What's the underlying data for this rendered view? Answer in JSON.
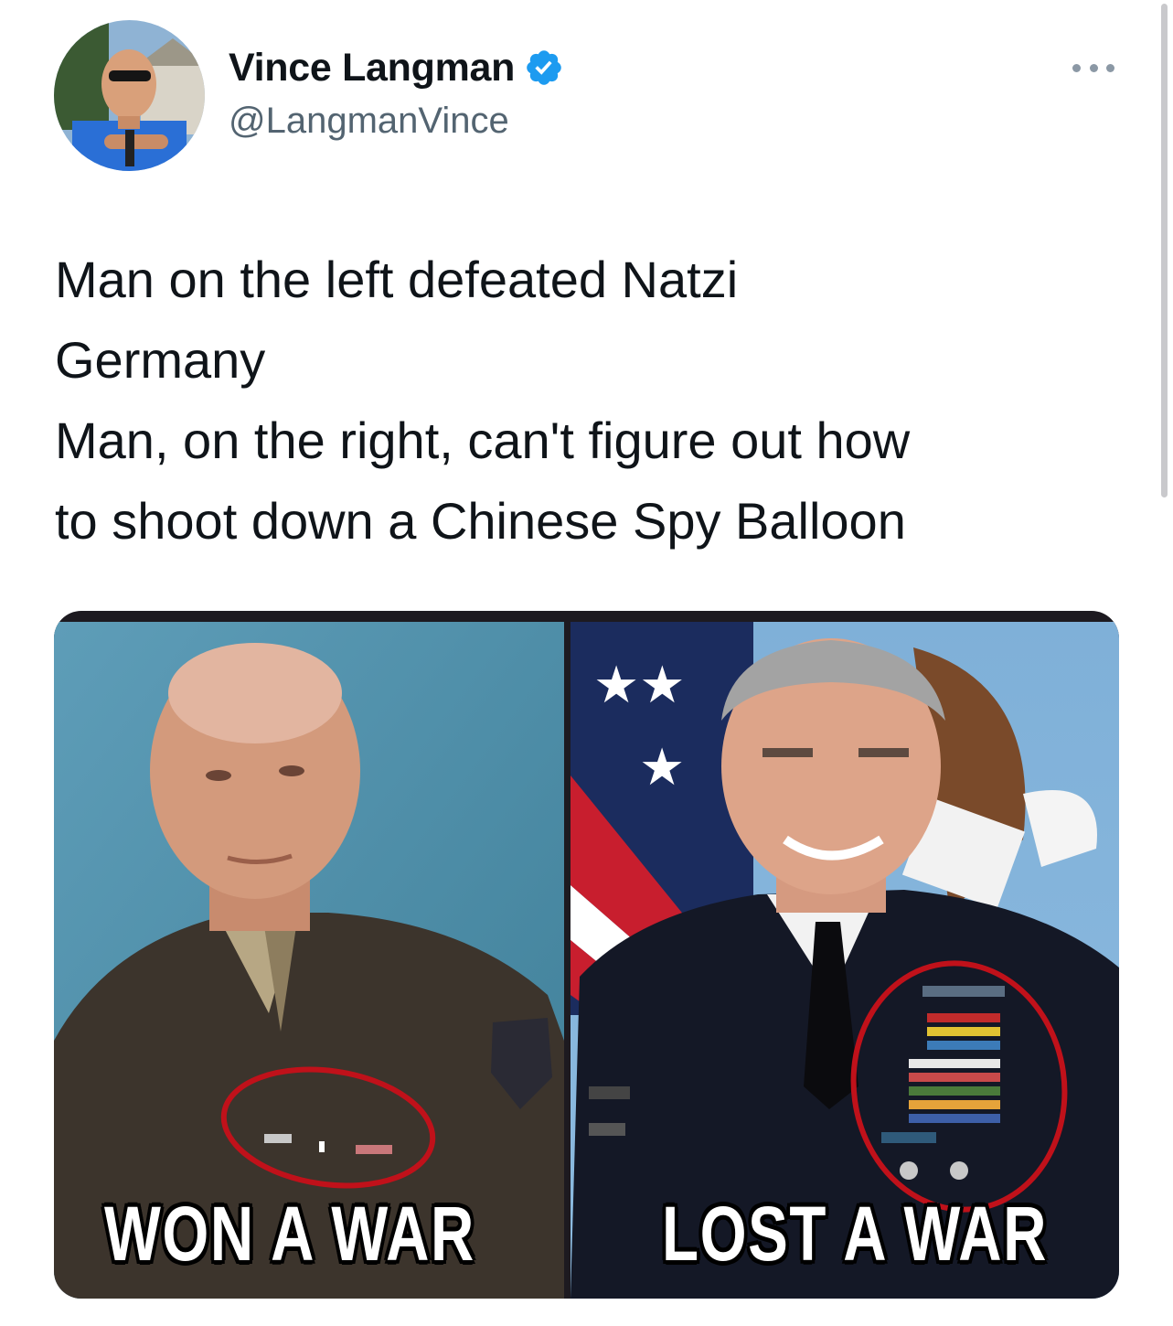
{
  "tweet": {
    "author": {
      "display_name": "Vince Langman",
      "handle": "@LangmanVince",
      "verified": true,
      "avatar_icon": "profile-photo"
    },
    "more_icon": "more-dots-icon",
    "text_lines": [
      "Man on the left defeated Natzi",
      "Germany",
      "Man, on the right, can't figure out how",
      "to shoot down a Chinese Spy Balloon"
    ],
    "media": {
      "left_caption": "WON A WAR",
      "right_caption": "LOST A WAR"
    }
  },
  "colors": {
    "verified_blue": "#1d9bf0",
    "secondary_text": "#536471",
    "circle_red": "#c0111a"
  }
}
